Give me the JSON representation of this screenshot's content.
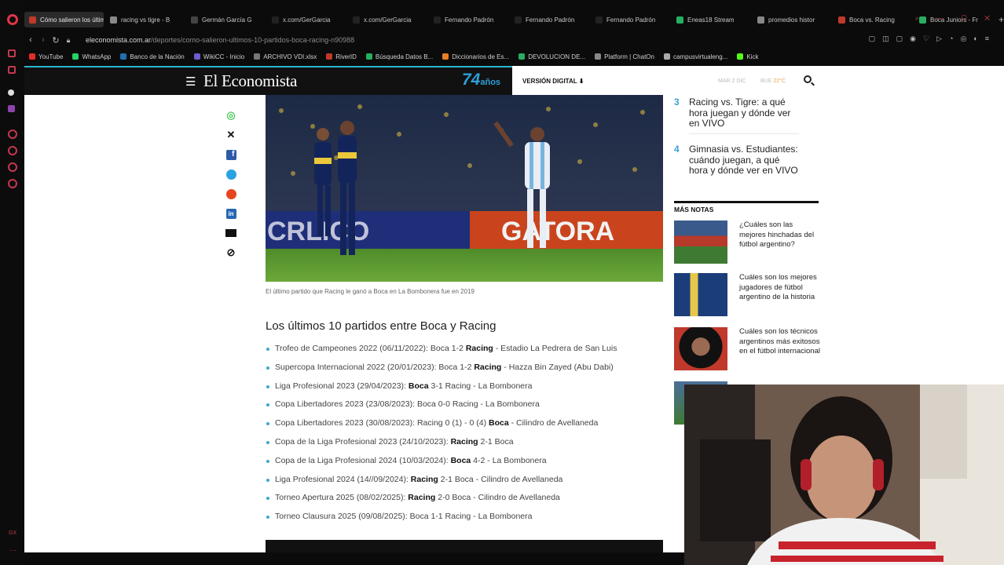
{
  "browser": {
    "tabs": [
      {
        "label": "Cómo salieron los último",
        "active": true,
        "fav": "#c0392b"
      },
      {
        "label": "racing vs tigre - B",
        "active": false,
        "fav": "#888"
      },
      {
        "label": "Germán García G",
        "active": false,
        "fav": "#444"
      },
      {
        "label": "x.com/GerGarcia",
        "active": false,
        "fav": "#222"
      },
      {
        "label": "x.com/GerGarcia",
        "active": false,
        "fav": "#222"
      },
      {
        "label": "Fernando Padrón",
        "active": false,
        "fav": "#222"
      },
      {
        "label": "Fernando Padrón",
        "active": false,
        "fav": "#222"
      },
      {
        "label": "Fernando Padrón",
        "active": false,
        "fav": "#222"
      },
      {
        "label": "Eneas18 Stream",
        "active": false,
        "fav": "#27ae60"
      },
      {
        "label": "promedios histor",
        "active": false,
        "fav": "#888"
      },
      {
        "label": "Boca vs. Racing",
        "active": false,
        "fav": "#c0392b"
      },
      {
        "label": "Boca Juniors - Fr",
        "active": false,
        "fav": "#27ae60"
      }
    ],
    "url_domain": "eleconomista.com.ar",
    "url_path": "/deportes/como-salieron-ultimos-10-partidos-boca-racing-n90988",
    "bookmarks": [
      {
        "label": "YouTube",
        "color": "#e52d27"
      },
      {
        "label": "WhatsApp",
        "color": "#25d366"
      },
      {
        "label": "Banco de la Nación",
        "color": "#1f6fb2"
      },
      {
        "label": "WikiCC - Inicio",
        "color": "#6b5ccf"
      },
      {
        "label": "ARCHIVO VDI.xlsx",
        "color": "#777"
      },
      {
        "label": "RiverID",
        "color": "#c0392b"
      },
      {
        "label": "Búsqueda Datos B...",
        "color": "#27ae60"
      },
      {
        "label": "Diccionarios de Es...",
        "color": "#e67e22"
      },
      {
        "label": "DEVOLUCION DE...",
        "color": "#27ae60"
      },
      {
        "label": "Platform | ChatOn",
        "color": "#888"
      },
      {
        "label": "campusvirtualeng...",
        "color": "#aaa"
      },
      {
        "label": "Kick",
        "color": "#53fc18"
      }
    ]
  },
  "header": {
    "brand": "El Economista",
    "anniversary": "74",
    "anniversary_suffix": "años",
    "version_digital": "VERSIÓN DIGITAL",
    "date": "MAR 2 DIC",
    "weather_city": "BUE",
    "weather_temp": "22°C"
  },
  "article": {
    "caption": "El último partido que Racing le ganó a Boca en La Bombonera fue en 2019",
    "heading": "Los últimos 10 partidos entre Boca y Racing",
    "matches": [
      [
        "Trofeo de Campeones 2022 (06/11/2022): Boca 1-2 ",
        "Racing",
        " - Estadio La Pedrera de San Luis"
      ],
      [
        "Supercopa Internacional 2022 (20/01/2023): Boca 1-2 ",
        "Racing",
        " - Hazza Bin Zayed (Abu Dabi)"
      ],
      [
        "Liga Profesional 2023 (29/04/2023): ",
        "Boca",
        " 3-1 Racing - La Bombonera"
      ],
      [
        "Copa Libertadores 2023 (23/08/2023): Boca 0-0 Racing - La Bombonera",
        "",
        ""
      ],
      [
        "Copa Libertadores 2023 (30/08/2023): Racing 0 (1) - 0 (4) ",
        "Boca",
        " - Cilindro de Avellaneda"
      ],
      [
        "Copa de la Liga Profesional 2023 (24/10/2023): ",
        "Racing",
        " 2-1 Boca"
      ],
      [
        "Copa de la Liga Profesional 2024 (10/03/2024): ",
        "Boca",
        " 4-2 - La Bombonera"
      ],
      [
        "Liga Profesional 2024 (14//09/2024): ",
        "Racing",
        " 2-1 Boca - Cilindro de Avellaneda"
      ],
      [
        "Torneo Apertura 2025 (08/02/2025): ",
        "Racing",
        " 2-0 Boca - Cilindro de Avellaneda"
      ],
      [
        "Torneo Clausura 2025 (09/08/2025): Boca 1-1 Racing - La Bombonera",
        "",
        ""
      ]
    ]
  },
  "sidebar": {
    "ranked": [
      {
        "n": "3",
        "title": "Racing vs. Tigre: a qué hora juegan y dónde ver en VIVO"
      },
      {
        "n": "4",
        "title": "Gimnasia vs. Estudiantes: cuándo juegan, a qué hora y dónde ver en VIVO"
      }
    ],
    "mas_notas_title": "MÁS NOTAS",
    "mas_notas": [
      "¿Cuáles son las mejores hinchadas del fútbol argentino?",
      "Cuáles son los mejores jugadores de fútbol argentino de la historia",
      "Cuáles son los técnicos argentinos más exitosos en el fútbol internacional"
    ]
  },
  "icons": [
    "whatsapp-icon",
    "x-icon",
    "facebook-icon",
    "telegram-icon",
    "reddit-icon",
    "linkedin-icon",
    "email-icon",
    "link-icon"
  ]
}
